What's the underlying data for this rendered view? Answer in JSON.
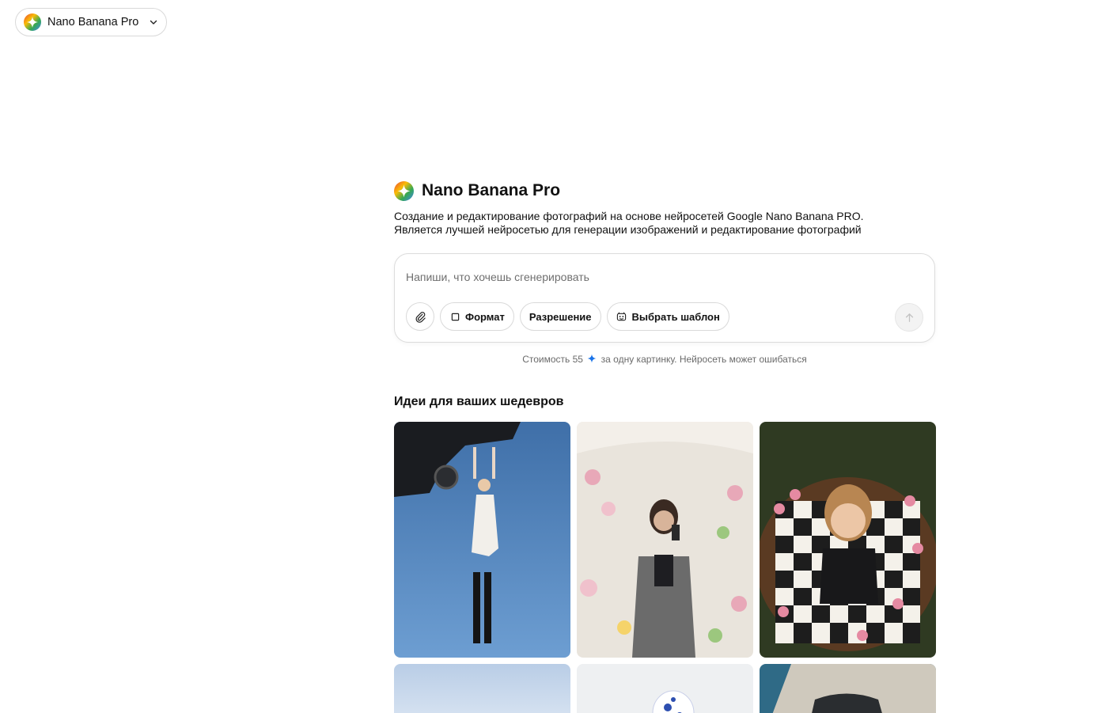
{
  "topbar": {
    "model_name": "Nano Banana Pro"
  },
  "header": {
    "title": "Nano Banana Pro",
    "description_line1": "Создание и редактирование фотографий на основе нейросетей Google Nano Banana PRO.",
    "description_line2": "Является лучшей нейросетью для генерации изображений и редактирование фотографий"
  },
  "prompt": {
    "placeholder": "Напиши, что хочешь сгенерировать",
    "value": "",
    "buttons": {
      "attach_icon": "paperclip-icon",
      "format_label": "Формат",
      "resolution_label": "Разрешение",
      "template_label": "Выбрать шаблон",
      "send_icon": "arrow-up-icon"
    }
  },
  "cost": {
    "prefix": "Стоимость 55",
    "suffix": "за одну картинку. Нейросеть может ошибаться"
  },
  "ideas": {
    "title": "Идеи для ваших шедевров",
    "images": [
      {
        "icon": "photo-woman-hanging-from-car"
      },
      {
        "icon": "photo-woman-mirror-selfie-flowers"
      },
      {
        "icon": "photo-woman-chessboard"
      },
      {
        "icon": "photo-sky-snow"
      },
      {
        "icon": "photo-porcelain-object"
      },
      {
        "icon": "photo-car-on-pier"
      }
    ]
  },
  "colors": {
    "accent_spark": "#1a73e8",
    "border": "#d9d9d9"
  }
}
